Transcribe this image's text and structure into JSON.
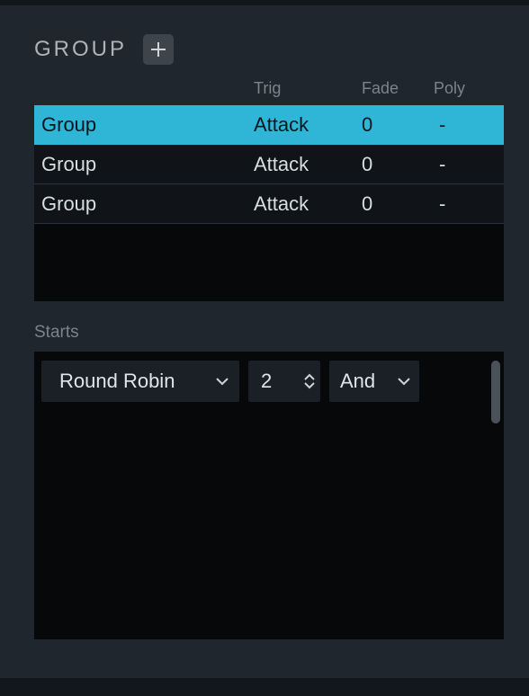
{
  "section": {
    "title": "GROUP"
  },
  "columns": {
    "name": "",
    "trig": "Trig",
    "fade": "Fade",
    "poly": "Poly"
  },
  "rows": [
    {
      "name": "Group",
      "trig": "Attack",
      "fade": "0",
      "poly": "-",
      "selected": true
    },
    {
      "name": "Group",
      "trig": "Attack",
      "fade": "0",
      "poly": "-",
      "selected": false
    },
    {
      "name": "Group",
      "trig": "Attack",
      "fade": "0",
      "poly": "-",
      "selected": false
    }
  ],
  "starts": {
    "label": "Starts",
    "mode": "Round Robin",
    "count": "2",
    "logic": "And"
  },
  "colors": {
    "selected_bg": "#2fb5d6"
  }
}
